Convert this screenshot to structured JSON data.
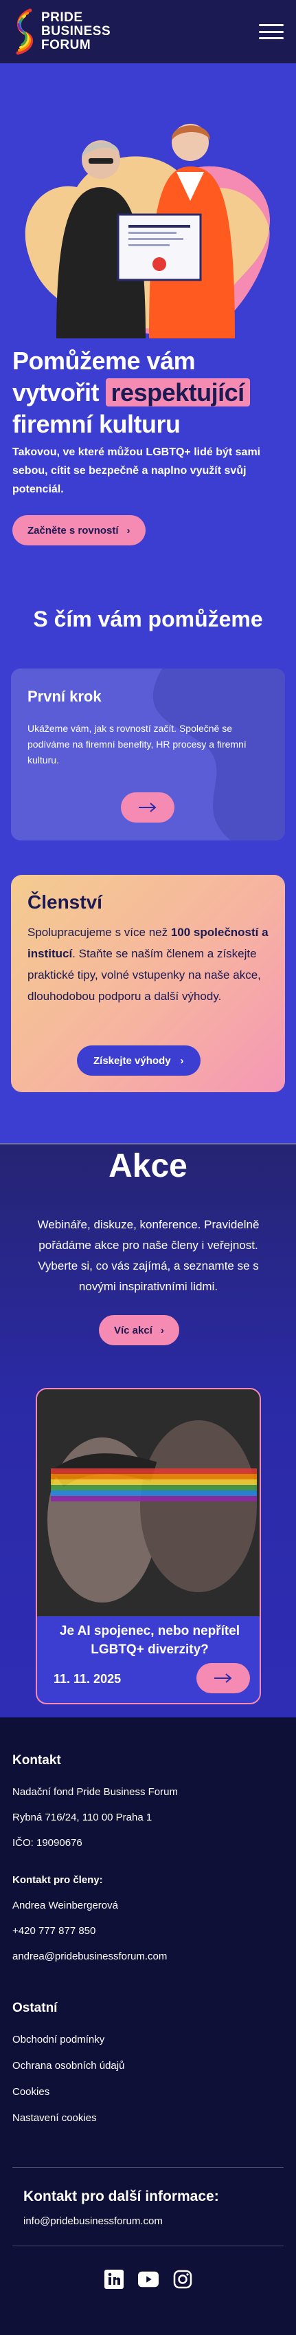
{
  "header": {
    "logo_lines": [
      "PRIDE",
      "BUSINESS",
      "FORUM"
    ],
    "menu_icon": "hamburger-icon"
  },
  "hero": {
    "title_part1": "Pomůžeme vám vytvořit ",
    "title_highlight": "respektující",
    "title_part2": " firemní kulturu",
    "text": "Takovou, ve které můžou LGBTQ+ lidé být sami sebou, cítit se bezpečně a naplno využít svůj potenciál.",
    "button_label": "Začněte s rovností"
  },
  "help": {
    "title": "S čím vám pomůžeme",
    "card": {
      "title": "První krok",
      "text": "Ukážeme vám, jak s rovností začít. Společně se podíváme na firemní benefity, HR procesy a firemní kulturu."
    }
  },
  "membership": {
    "title": "Členství",
    "text_part1": "Spolupracujeme s více než ",
    "text_bold": "100 společností a institucí",
    "text_part2": ". Staňte se naším členem a získejte praktické tipy, volné vstupenky na naše akce, dlouhodobou podporu a další výhody.",
    "button_label": "Získejte výhody"
  },
  "events": {
    "title": "Akce",
    "text": "Webináře, diskuze, konference. Pravidelně pořádáme akce pro naše členy i veřejnost. Vyberte si, co vás zajímá, a seznamte se s novými inspirativními lidmi.",
    "button_label": "Víc akcí",
    "card": {
      "title": "Je AI spojenec, nebo nepřítel LGBTQ+ diverzity?",
      "date": "11. 11. 2025"
    }
  },
  "footer": {
    "contact_heading": "Kontakt",
    "org_name": "Nadační fond Pride Business Forum",
    "address": "Rybná 716/24, 110 00 Praha 1",
    "ico": "IČO: 19090676",
    "members_heading": "Kontakt pro členy:",
    "members_name": "Andrea Weinbergerová",
    "members_phone": "+420 777 877 850",
    "members_email": "andrea@pridebusinessforum.com",
    "other_heading": "Ostatní",
    "links": [
      "Obchodní podmínky",
      "Ochrana osobních údajů",
      "Cookies",
      "Nastavení cookies"
    ],
    "more_info_heading": "Kontakt pro další informace:",
    "more_info_email": "info@pridebusinessforum.com",
    "social_icons": [
      "linkedin-icon",
      "youtube-icon",
      "instagram-icon"
    ]
  },
  "colors": {
    "navy": "#1b1a52",
    "royal_blue": "#3b3ed1",
    "pink": "#f58bb3",
    "footer": "#0f1038"
  }
}
